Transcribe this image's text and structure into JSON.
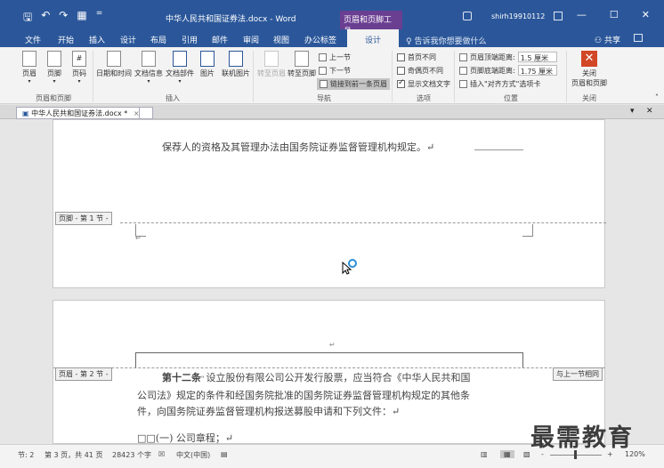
{
  "titlebar": {
    "save_icon": "save-icon",
    "undo_icon": "undo-icon",
    "redo_icon": "redo-icon",
    "format_icon": "format-painter-icon",
    "customize": "=",
    "title": "中华人民共和国证券法.docx - Word",
    "context_tools": "页眉和页脚工具",
    "user": "shirh19910112",
    "min": "—",
    "max": "☐",
    "close": "✕"
  },
  "tabs": {
    "file": "文件",
    "home": "开始",
    "insert": "插入",
    "design": "设计",
    "layout": "布局",
    "references": "引用",
    "mailings": "邮件",
    "review": "审阅",
    "view": "视图",
    "addin": "办公标签",
    "hf_design": "设计",
    "tell_me": "告诉我你想要做什么",
    "share": "共享"
  },
  "ribbon": {
    "header": "页眉",
    "footer": "页脚",
    "page_number": "页码",
    "group_hf": "页眉和页脚",
    "date_time": "日期和时间",
    "doc_info": "文档信息",
    "quick_parts": "文档部件",
    "picture": "图片",
    "online_picture": "联机图片",
    "group_insert": "插入",
    "goto_header": "转至页眉",
    "goto_footer": "转至页脚",
    "prev_section": "上一节",
    "next_section": "下一节",
    "link_to_prev": "链接到前一条页眉",
    "group_nav": "导航",
    "diff_first": "首页不同",
    "diff_odd_even": "奇偶页不同",
    "show_doc_text": "显示文档文字",
    "group_options": "选项",
    "header_top": "页眉顶端距离:",
    "header_top_val": "1.5 厘米",
    "footer_bottom": "页脚底端距离:",
    "footer_bottom_val": "1.75 厘米",
    "insert_align_tab": "插入\"对齐方式\"选项卡",
    "group_position": "位置",
    "close_hf": "关闭\n页眉和页脚",
    "close_hf_1": "关闭",
    "close_hf_2": "页眉和页脚",
    "group_close": "关闭"
  },
  "docbar": {
    "tab_label": "中华人民共和国证券法.docx *",
    "tab_close": "×",
    "menu": "▾",
    "close": "✕"
  },
  "document": {
    "p1_text": "保荐人的资格及其管理办法由国务院证券监督管理机构规定。↵",
    "footer_tag": "页脚 - 第 1 节 -",
    "header_tag": "页眉 - 第 2 节 -",
    "same_as_prev": "与上一节相同",
    "para_mark": "↵",
    "art12_bold": "第十二条",
    "art12_line1": "设立股份有限公司公开发行股票，应当符合《中华人民共和国",
    "art12_line2": "公司法》规定的条件和经国务院批准的国务院证券监督管理机构规定的其他条",
    "art12_line3": "件，向国务院证券监督管理机构报送募股申请和下列文件：↵",
    "list_item": "□□(一) 公司章程；↵"
  },
  "statusbar": {
    "section": "节: 2",
    "page": "第 3 页，共 41 页",
    "words": "28423 个字",
    "lang": "中文(中国)",
    "zoom_minus": "-",
    "zoom_plus": "+",
    "zoom": "120%"
  },
  "watermark": "最需教育",
  "colors": {
    "accent": "#2b579a",
    "context": "#6a3f92",
    "close_red": "#d24726"
  }
}
